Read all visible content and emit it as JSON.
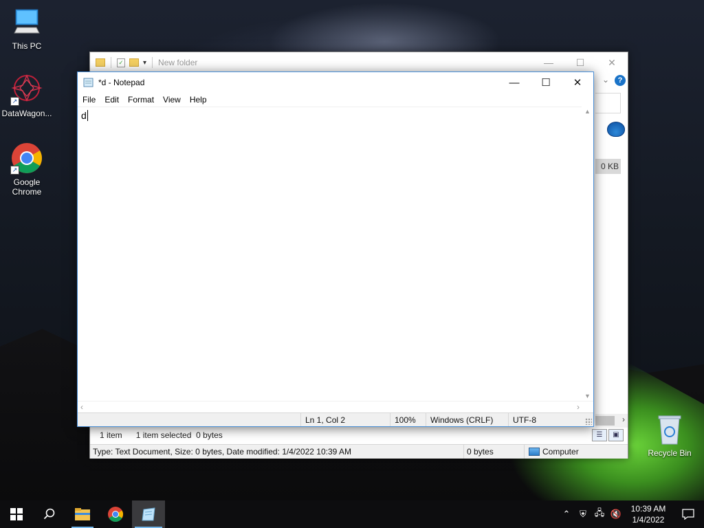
{
  "desktop": {
    "icons": [
      {
        "label": "This PC",
        "icon": "computer-icon"
      },
      {
        "label": "DataWagon...",
        "icon": "datawagon-icon"
      },
      {
        "label": "Google Chrome",
        "icon": "chrome-icon"
      },
      {
        "label": "Recycle Bin",
        "icon": "recycle-bin-icon"
      }
    ]
  },
  "explorer": {
    "title": "New folder",
    "size_cell": "0 KB",
    "status": {
      "items": "1 item",
      "selected": "1 item selected",
      "size": "0 bytes"
    },
    "details_bar": {
      "type_info": "Type: Text Document, Size: 0 bytes, Date modified: 1/4/2022 10:39 AM",
      "bytes": "0 bytes",
      "location": "Computer"
    }
  },
  "notepad": {
    "title": "*d - Notepad",
    "menu": [
      "File",
      "Edit",
      "Format",
      "View",
      "Help"
    ],
    "content": "d",
    "status": {
      "position": "Ln 1, Col 2",
      "zoom": "100%",
      "line_ending": "Windows (CRLF)",
      "encoding": "UTF-8"
    }
  },
  "taskbar": {
    "clock_time": "10:39 AM",
    "clock_date": "1/4/2022"
  },
  "colors": {
    "accent": "#76b9ed",
    "window_border": "#4a90d9",
    "taskbar": "#0d0d0f"
  }
}
